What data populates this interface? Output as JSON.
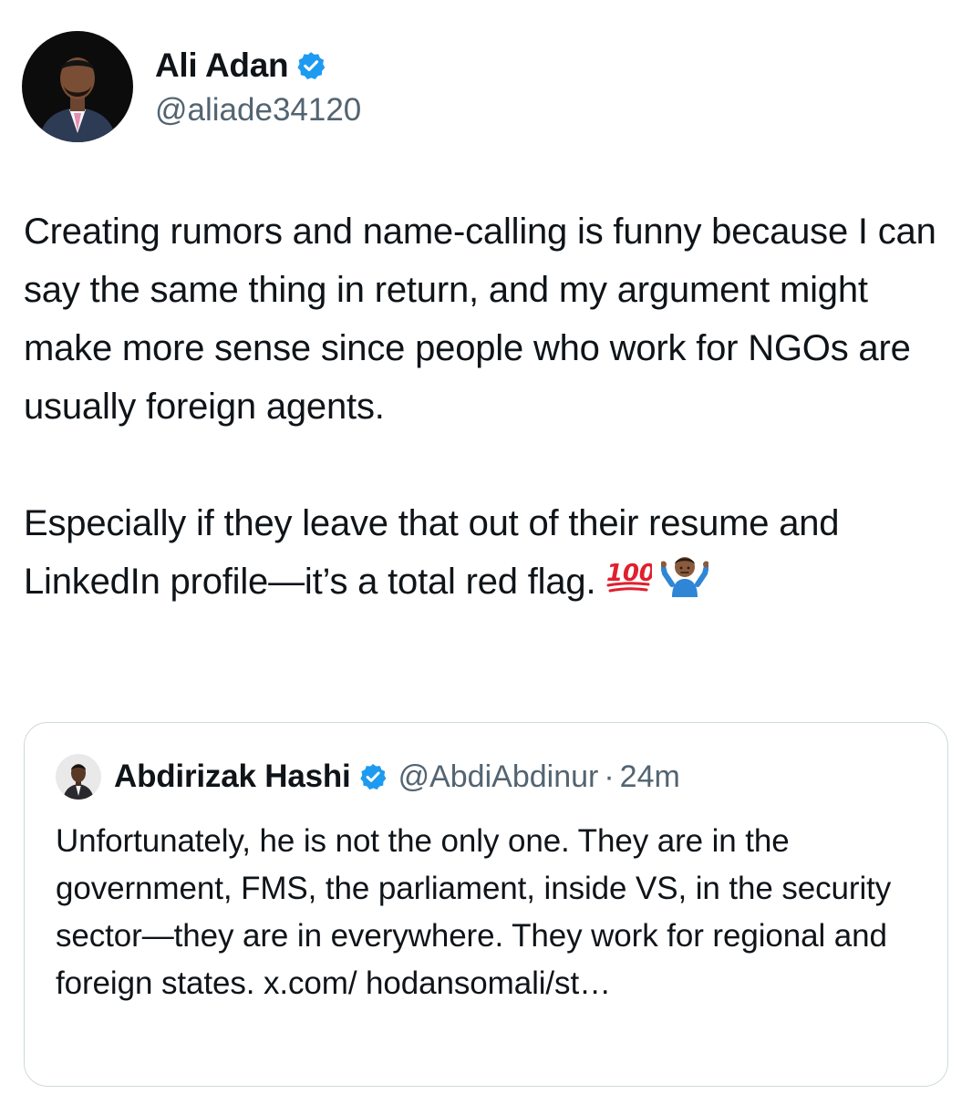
{
  "author": {
    "display_name": "Ali Adan",
    "handle": "@aliade34120",
    "verified": true,
    "avatar_icon": "profile-photo-avatar",
    "verified_icon": "verified-badge-icon",
    "verified_color": "#1d9bf0"
  },
  "tweet": {
    "paragraph_1": "Creating rumors and name-calling is funny because I can say the same thing in return, and my argument might make more sense since people who work for NGOs are usually foreign agents.",
    "paragraph_2": "Especially if they leave that out of their resume and LinkedIn profile—it’s a total red flag.",
    "emojis": [
      "hundred-points-emoji",
      "person-shrugging-emoji"
    ]
  },
  "quoted_tweet": {
    "display_name": "Abdirizak Hashi",
    "handle": "@AbdiAbdinur",
    "separator": "·",
    "time": "24m",
    "verified": true,
    "text": "Unfortunately, he is not the only one. They are in the government, FMS, the parliament, inside VS, in the security sector—they are in everywhere. They work for regional and foreign states. x.com/ hodansomali/st…"
  },
  "colors": {
    "text_primary": "#0f1419",
    "text_secondary": "#536471",
    "border": "#cfd9de",
    "verified_blue": "#1d9bf0"
  }
}
